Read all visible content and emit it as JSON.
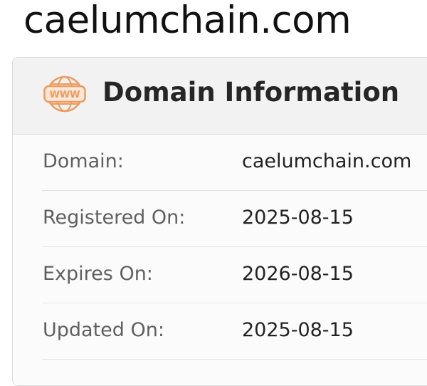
{
  "page": {
    "title": "caelumchain.com"
  },
  "card": {
    "title": "Domain Information",
    "icon": "www-globe-icon",
    "icon_text": "WWW",
    "accent_color": "#ee9a5d"
  },
  "rows": [
    {
      "label": "Domain:",
      "value": "caelumchain.com"
    },
    {
      "label": "Registered On:",
      "value": "2025-08-15"
    },
    {
      "label": "Expires On:",
      "value": "2026-08-15"
    },
    {
      "label": "Updated On:",
      "value": "2025-08-15"
    }
  ]
}
